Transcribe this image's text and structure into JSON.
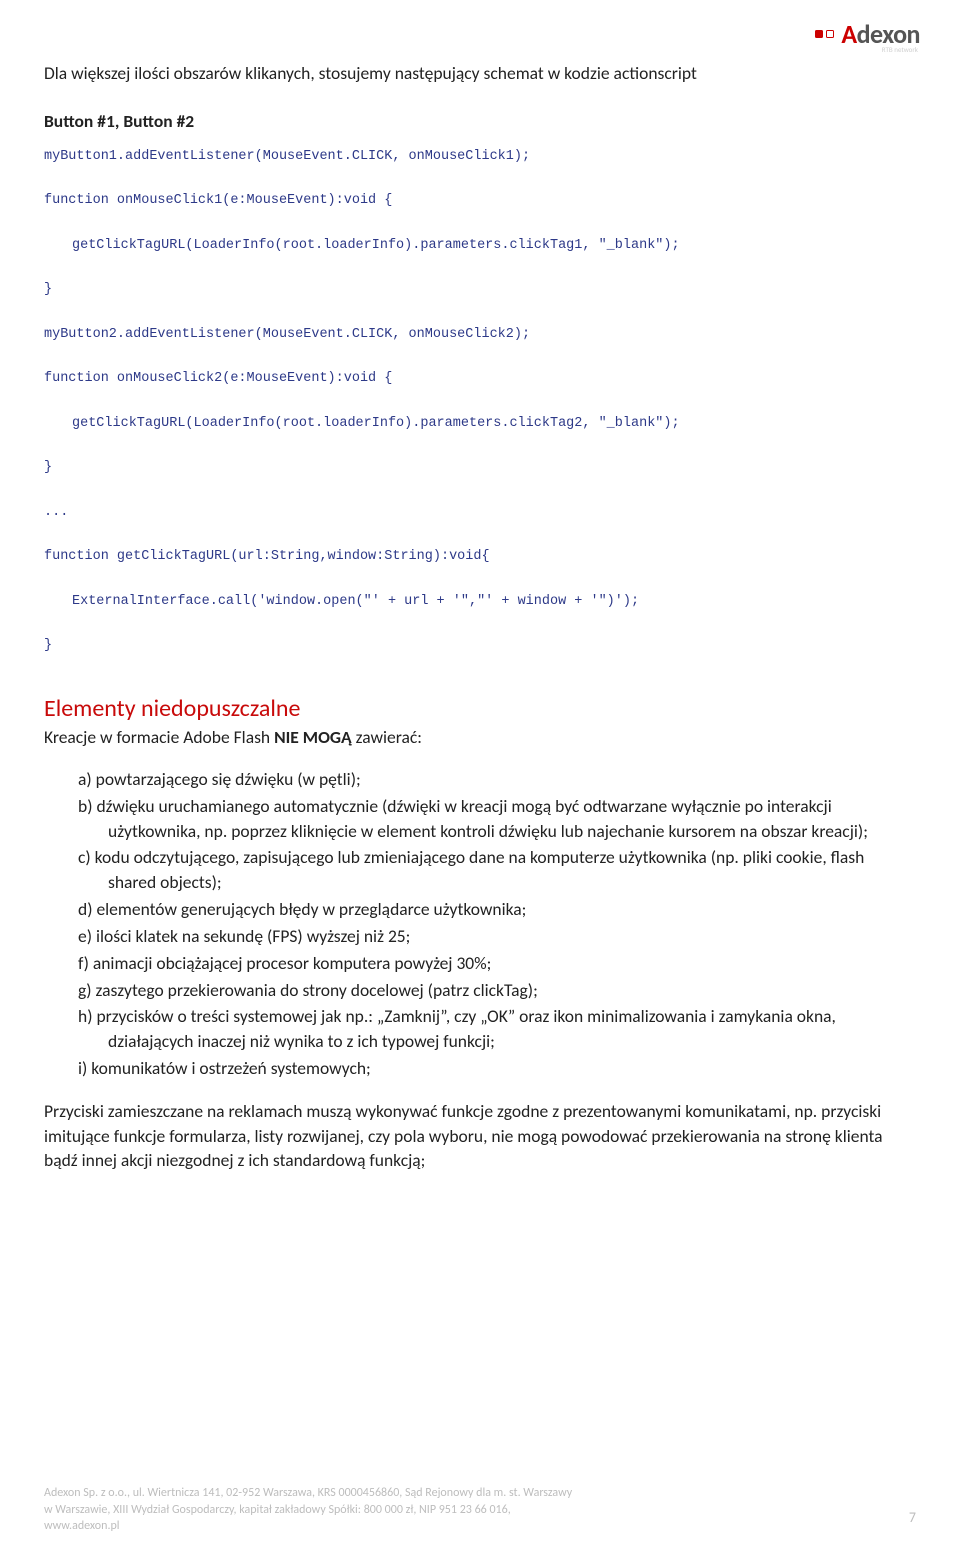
{
  "logo": {
    "brand": "Adexon",
    "subtitle": "RTB network"
  },
  "intro": "Dla większej ilości obszarów klikanych, stosujemy następujący schemat w kodzie actionscript",
  "subhead": "Button #1, Button #2",
  "code": {
    "l1": "myButton1.addEventListener(MouseEvent.CLICK, onMouseClick1);",
    "l2": "function onMouseClick1(e:MouseEvent):void {",
    "l3": "getClickTagURL(LoaderInfo(root.loaderInfo).parameters.clickTag1, \"_blank\");",
    "l4": "}",
    "l5": "myButton2.addEventListener(MouseEvent.CLICK, onMouseClick2);",
    "l6": "function onMouseClick2(e:MouseEvent):void {",
    "l7": "getClickTagURL(LoaderInfo(root.loaderInfo).parameters.clickTag2, \"_blank\");",
    "l8": "}",
    "l9": "...",
    "l10": "function getClickTagURL(url:String,window:String):void{",
    "l11": "ExternalInterface.call('window.open(\"' + url + '\",\"' + window + '\")');",
    "l12": "}"
  },
  "section": {
    "heading": "Elementy niedopuszczalne",
    "lead_pre": "Kreacje w formacie Adobe Flash ",
    "lead_bold": "NIE MOGĄ",
    "lead_post": " zawierać:",
    "items": {
      "a": "a)   powtarzającego się dźwięku (w pętli);",
      "b": "b)   dźwięku uruchamianego automatycznie (dźwięki w kreacji mogą być odtwarzane wyłącznie po interakcji użytkownika, np. poprzez kliknięcie w element kontroli dźwięku lub najechanie kursorem na obszar kreacji);",
      "c": "c)   kodu odczytującego, zapisującego lub zmieniającego dane na komputerze użytkownika (np. pliki cookie, flash shared objects);",
      "d": "d)   elementów generujących błędy w przeglądarce użytkownika;",
      "e": "e)   ilości klatek na sekundę (FPS) wyższej niż 25;",
      "f": "f)    animacji obciążającej procesor komputera powyżej 30%;",
      "g": "g)   zaszytego przekierowania do strony docelowej (patrz clickTag);",
      "h": "h)   przycisków o treści systemowej jak np.: „Zamknij”, czy „OK” oraz ikon minimalizowania i zamykania okna, działających inaczej niż wynika to z ich typowej funkcji;",
      "i": "i)    komunikatów i ostrzeżeń systemowych;"
    },
    "tail": "Przyciski zamieszczane na reklamach muszą wykonywać funkcje zgodne z prezentowanymi komunikatami, np. przyciski imitujące funkcje formularza, listy rozwijanej, czy pola wyboru, nie mogą powodować przekierowania na stronę klienta bądź innej akcji niezgodnej z ich standardową funkcją;"
  },
  "footer": {
    "line1": "Adexon Sp. z o.o., ul. Wiertnicza 141, 02-952 Warszawa, KRS 0000456860, Sąd Rejonowy dla m. st. Warszawy",
    "line2": "w Warszawie, XIII Wydział Gospodarczy, kapitał zakładowy Spółki: 800 000 zł, NIP 951 23 66 016,",
    "line3": "www.adexon.pl",
    "page": "7"
  }
}
